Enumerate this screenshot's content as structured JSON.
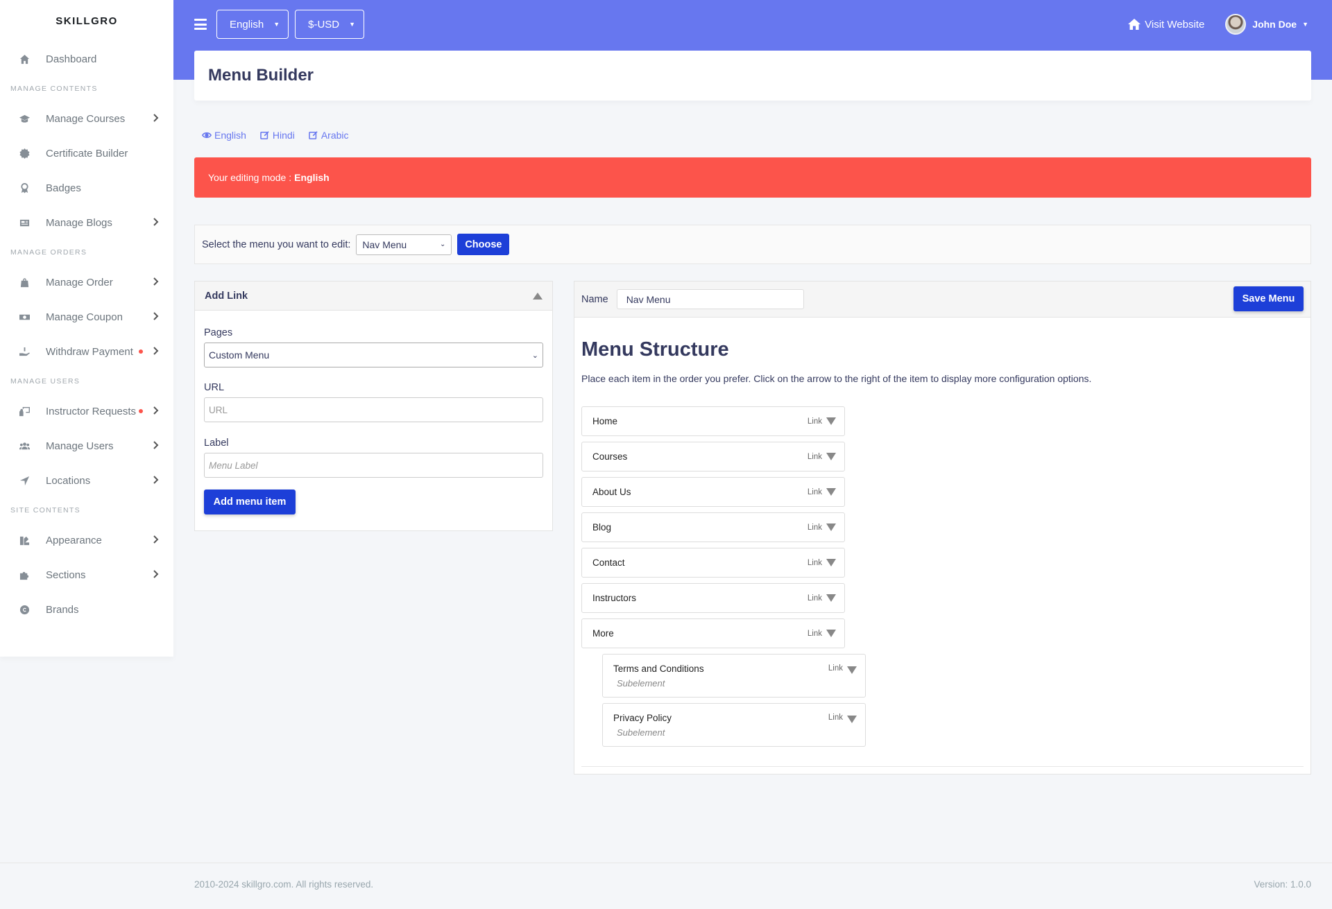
{
  "sidebar": {
    "brand": "SKILLGRO",
    "dashboard": {
      "label": "Dashboard",
      "icon": "home-icon"
    },
    "sections": [
      {
        "header": "MANAGE CONTENTS",
        "items": [
          {
            "label": "Manage Courses",
            "icon": "graduation-cap-icon",
            "chevron": true,
            "dot": false
          },
          {
            "label": "Certificate Builder",
            "icon": "certificate-icon",
            "chevron": false,
            "dot": false
          },
          {
            "label": "Badges",
            "icon": "award-icon",
            "chevron": false,
            "dot": false
          },
          {
            "label": "Manage Blogs",
            "icon": "newspaper-icon",
            "chevron": true,
            "dot": false
          }
        ]
      },
      {
        "header": "MANAGE ORDERS",
        "items": [
          {
            "label": "Manage Order",
            "icon": "shopping-bag-icon",
            "chevron": true,
            "dot": false
          },
          {
            "label": "Manage Coupon",
            "icon": "money-bill-icon",
            "chevron": true,
            "dot": false
          },
          {
            "label": "Withdraw Payment",
            "icon": "hand-holding-usd-icon",
            "chevron": true,
            "dot": true
          }
        ]
      },
      {
        "header": "MANAGE USERS",
        "items": [
          {
            "label": "Instructor Requests",
            "icon": "chalkboard-teacher-icon",
            "chevron": true,
            "dot": true
          },
          {
            "label": "Manage Users",
            "icon": "users-icon",
            "chevron": true,
            "dot": false
          },
          {
            "label": "Locations",
            "icon": "location-arrow-icon",
            "chevron": true,
            "dot": false
          }
        ]
      },
      {
        "header": "SITE CONTENTS",
        "items": [
          {
            "label": "Appearance",
            "icon": "palette-icon",
            "chevron": true,
            "dot": false
          },
          {
            "label": "Sections",
            "icon": "puzzle-piece-icon",
            "chevron": true,
            "dot": false
          },
          {
            "label": "Brands",
            "icon": "copyright-icon",
            "chevron": false,
            "dot": false
          }
        ]
      }
    ]
  },
  "topbar": {
    "language": "English",
    "currency": "$-USD",
    "visit_website": "Visit Website",
    "user_name": "John Doe"
  },
  "page": {
    "title": "Menu Builder",
    "lang_links": [
      {
        "label": "English",
        "icon": "eye-icon"
      },
      {
        "label": "Hindi",
        "icon": "edit-icon"
      },
      {
        "label": "Arabic",
        "icon": "edit-icon"
      }
    ],
    "alert_prefix": "Your editing mode :",
    "alert_mode": "English"
  },
  "menu_select": {
    "label": "Select the menu you want to edit:",
    "selected": "Nav Menu",
    "button": "Choose"
  },
  "add_link": {
    "title": "Add Link",
    "pages_label": "Pages",
    "pages_value": "Custom Menu",
    "url_label": "URL",
    "url_placeholder": "URL",
    "label_label": "Label",
    "label_placeholder": "Menu Label",
    "button": "Add menu item"
  },
  "menu_structure": {
    "name_label": "Name",
    "name_value": "Nav Menu",
    "save_button": "Save Menu",
    "title": "Menu Structure",
    "description": "Place each item in the order you prefer. Click on the arrow to the right of the item to display more configuration options.",
    "items": [
      {
        "label": "Home",
        "type": "Link"
      },
      {
        "label": "Courses",
        "type": "Link"
      },
      {
        "label": "About Us",
        "type": "Link"
      },
      {
        "label": "Blog",
        "type": "Link"
      },
      {
        "label": "Contact",
        "type": "Link"
      },
      {
        "label": "Instructors",
        "type": "Link"
      },
      {
        "label": "More",
        "type": "Link"
      }
    ],
    "subitems": [
      {
        "label": "Terms and Conditions",
        "type": "Link",
        "note": "Subelement"
      },
      {
        "label": "Privacy Policy",
        "type": "Link",
        "note": "Subelement"
      }
    ]
  },
  "footer": {
    "copyright": "2010-2024 skillgro.com. All rights reserved.",
    "version": "Version: 1.0.0"
  },
  "colors": {
    "primary": "#6777ef",
    "button": "#1d3fd8",
    "alert": "#fc544b"
  }
}
